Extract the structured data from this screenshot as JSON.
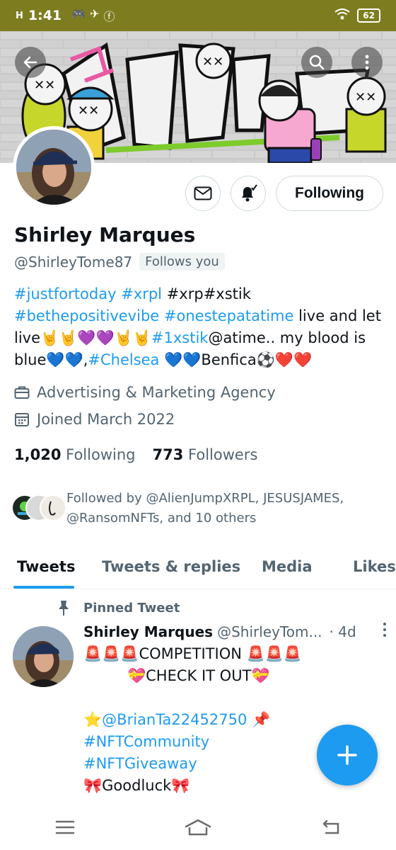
{
  "status_bar": {
    "signal": "H",
    "time": "1:41",
    "battery": "62"
  },
  "profile": {
    "name": "Shirley Marques",
    "handle": "@ShirleyTome87",
    "follows_you": "Follows you",
    "follow_button": "Following",
    "bio": {
      "l1_t1": "#justfortoday",
      "l1_t2": "#xrpl",
      "l1_t3": "#xrp#xstik",
      "l2_t1": "#bethepositivevibe",
      "l2_t2": "#onestepatatime",
      "l2_t3": "live and let",
      "l3_t1": "live🤘🤘💜💜🤘🤘",
      "l3_t2": "#1xstik",
      "l3_t3": "@atime.. my blood is",
      "l4_t1": "blue💙💙,",
      "l4_t2": "#Chelsea",
      "l4_t3": "💙💙Benfica⚽❤️❤️"
    },
    "category": "Advertising & Marketing Agency",
    "joined": "Joined March 2022",
    "following_count": "1,020",
    "following_label": "Following",
    "followers_count": "773",
    "followers_label": "Followers",
    "followed_by": "Followed by @AlienJumpXRPL, JESUSJAMES, @RansomNFTs, and 10 others"
  },
  "tabs": [
    "Tweets",
    "Tweets & replies",
    "Media",
    "Likes"
  ],
  "pinned_label": "Pinned Tweet",
  "tweet": {
    "name": "Shirley Marques",
    "handle": "@ShirleyTom...",
    "date": "· 4d",
    "line1": "🚨🚨🚨COMPETITION 🚨🚨🚨",
    "line2": "💝CHECK IT OUT💝",
    "line3_icon": "⭐",
    "line3_mention": "@BrianTa22452750",
    "line3_pin": "📌",
    "line4": "#NFTCommunity",
    "line5": "#NFTGiveaway",
    "line6": "🎀Goodluck🎀"
  },
  "colors": {
    "accent": "#1d9bf0",
    "status_bar": "#7d7d1f"
  }
}
